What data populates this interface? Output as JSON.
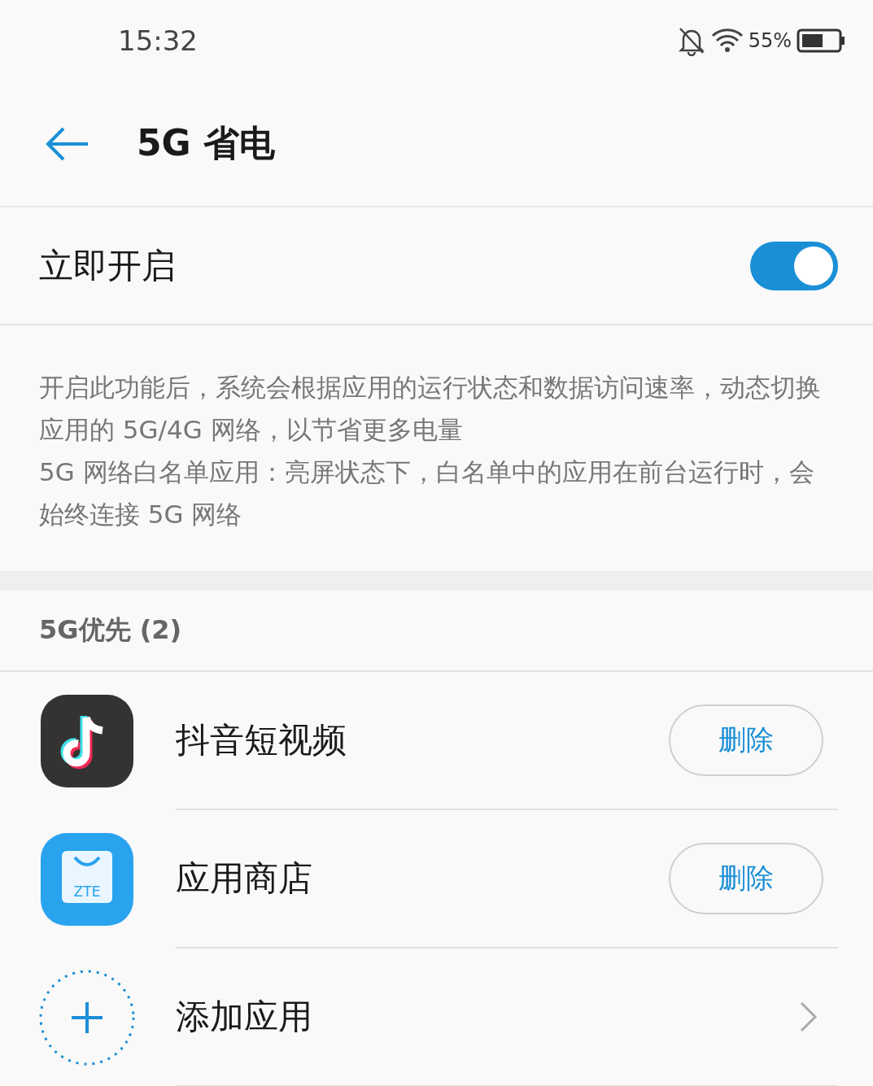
{
  "status_bar": {
    "time": "15:32",
    "battery_text": "55%"
  },
  "header": {
    "title": "5G 省电"
  },
  "toggle_row": {
    "label": "立即开启",
    "on": true
  },
  "description": [
    "开启此功能后，系统会根据应用的运行状态和数据访问速率，动态切换应用的 5G/4G 网络，以节省更多电量",
    "5G 网络白名单应用：亮屏状态下，白名单中的应用在前台运行时，会始终连接 5G 网络"
  ],
  "section": {
    "title": "5G优先 (2)"
  },
  "apps": [
    {
      "kind": "video",
      "name": "抖音短视频",
      "button": "删除"
    },
    {
      "kind": "store",
      "name": "应用商店",
      "button": "删除",
      "icon_text": "ZTE"
    },
    {
      "kind": "add",
      "name": "添加应用"
    }
  ]
}
